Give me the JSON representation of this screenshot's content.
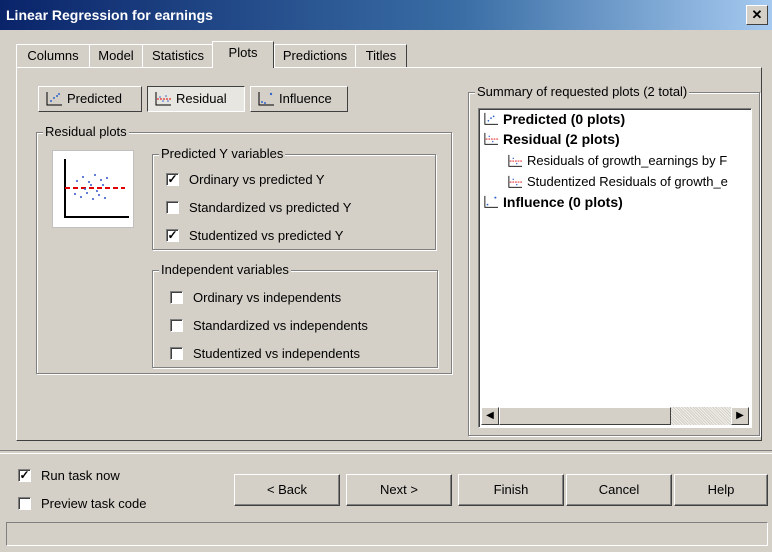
{
  "window": {
    "title": "Linear Regression for earnings",
    "close_glyph": "✕"
  },
  "tabs": [
    {
      "label": "Columns"
    },
    {
      "label": "Model"
    },
    {
      "label": "Statistics"
    },
    {
      "label": "Plots",
      "active": true
    },
    {
      "label": "Predictions"
    },
    {
      "label": "Titles"
    }
  ],
  "plot_type_buttons": {
    "predicted": "Predicted",
    "residual": "Residual",
    "influence": "Influence",
    "pressed": "residual"
  },
  "residual_plots": {
    "label": "Residual plots",
    "predicted_group": {
      "label": "Predicted Y variables",
      "options": [
        {
          "label": "Ordinary vs predicted Y",
          "checked": true
        },
        {
          "label": "Standardized vs predicted Y",
          "checked": false
        },
        {
          "label": "Studentized vs predicted Y",
          "checked": true
        }
      ]
    },
    "independent_group": {
      "label": "Independent variables",
      "options": [
        {
          "label": "Ordinary vs independents",
          "checked": false
        },
        {
          "label": "Standardized vs independents",
          "checked": false
        },
        {
          "label": "Studentized vs independents",
          "checked": false
        }
      ]
    }
  },
  "summary": {
    "label": "Summary of requested plots (2 total)",
    "items": [
      {
        "label": "Predicted (0 plots)",
        "icon": "predicted-plot-icon"
      },
      {
        "label": "Residual (2 plots)",
        "icon": "residual-plot-icon"
      },
      {
        "label": "Residuals of growth_earnings by F",
        "icon": "residual-plot-icon"
      },
      {
        "label": "Studentized Residuals of growth_e",
        "icon": "residual-plot-icon"
      },
      {
        "label": "Influence (0 plots)",
        "icon": "influence-plot-icon"
      }
    ]
  },
  "options": {
    "run_task_now": {
      "label": "Run task now",
      "checked": true
    },
    "preview_task_code": {
      "label": "Preview task code",
      "checked": false
    }
  },
  "buttons": {
    "back": "< Back",
    "next": "Next >",
    "finish": "Finish",
    "cancel": "Cancel",
    "help": "Help"
  },
  "colors": {
    "titlebar": "#0a246a",
    "accent_red": "#e00000",
    "dots": "#3355cc"
  }
}
